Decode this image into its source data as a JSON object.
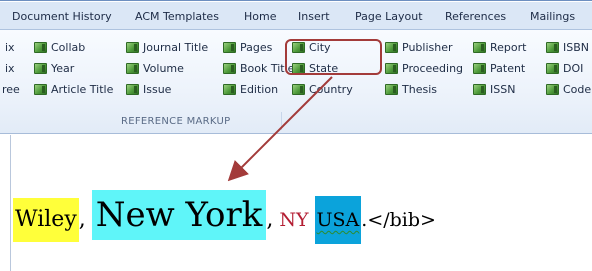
{
  "tabs": [
    {
      "label": "Document History"
    },
    {
      "label": "ACM Templates"
    },
    {
      "label": "Home"
    },
    {
      "label": "Insert"
    },
    {
      "label": "Page Layout"
    },
    {
      "label": "References"
    },
    {
      "label": "Mailings"
    }
  ],
  "ribbon": {
    "left_fragments": [
      "ix",
      "ix",
      "ree"
    ],
    "col1": [
      "Collab",
      "Year",
      "Article Title"
    ],
    "col2": [
      "Journal Title",
      "Volume",
      "Issue"
    ],
    "col3": [
      "Pages",
      "Book Title",
      "Edition"
    ],
    "col4": [
      "City",
      "State",
      "Country"
    ],
    "col5": [
      "Publisher",
      "Proceeding",
      "Thesis"
    ],
    "col6": [
      "Report",
      "Patent",
      "ISSN"
    ],
    "col7": [
      "ISBN",
      "DOI",
      "Code"
    ],
    "group_label": "REFERENCE MARKUP"
  },
  "document": {
    "publisher": "Wiley",
    "comma1": ",",
    "city": "New York",
    "comma2": ",",
    "state": "NY",
    "country": "USA",
    "tail": ".</bib>"
  },
  "colors": {
    "highlight_box": "#a33b3a",
    "publisher_bg": "#ffff3a",
    "city_bg": "#5ff5f9",
    "state_text": "#b41e33",
    "country_bg": "#0ba3db"
  }
}
